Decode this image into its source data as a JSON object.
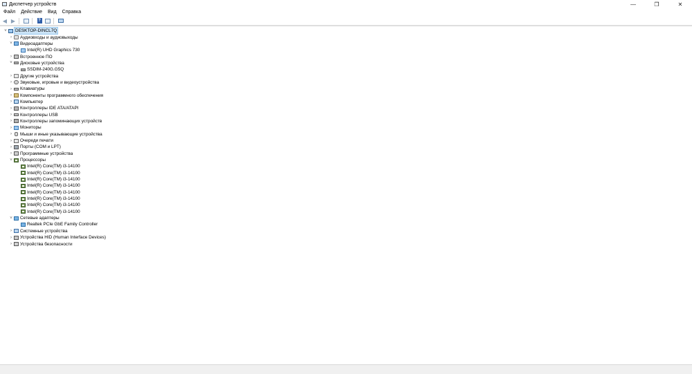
{
  "window": {
    "title": "Диспетчер устройств",
    "minimize_glyph": "—",
    "restore_glyph": "❐",
    "close_glyph": "✕"
  },
  "menu": [
    "Файл",
    "Действие",
    "Вид",
    "Справка"
  ],
  "toolbar": {
    "back_glyph": "◀",
    "forward_glyph": "▶",
    "help_glyph": "?"
  },
  "tree": [
    {
      "level": 0,
      "expander": "˅",
      "icon": "computer-icon",
      "label": "DESKTOP-DINCL7Q",
      "selected": true
    },
    {
      "level": 1,
      "expander": "›",
      "icon": "audio-io-icon",
      "label": "Аудиовходы и аудиовыходы"
    },
    {
      "level": 1,
      "expander": "˅",
      "icon": "display-adapter-icon",
      "label": "Видеоадаптеры"
    },
    {
      "level": 2,
      "expander": "",
      "icon": "monitor-icon",
      "label": "Intel(R) UHD Graphics 730"
    },
    {
      "level": 1,
      "expander": "›",
      "icon": "firmware-icon",
      "label": "Встроенное ПО"
    },
    {
      "level": 1,
      "expander": "˅",
      "icon": "disk-drive-icon",
      "label": "Дисковые устройства"
    },
    {
      "level": 2,
      "expander": "",
      "icon": "disk-icon",
      "label": "SSDIM-240G.G5Q"
    },
    {
      "level": 1,
      "expander": "›",
      "icon": "other-devices-icon",
      "label": "Другие устройства"
    },
    {
      "level": 1,
      "expander": "›",
      "icon": "sound-icon",
      "label": "Звуковые, игровые и видеоустройства"
    },
    {
      "level": 1,
      "expander": "›",
      "icon": "keyboard-icon",
      "label": "Клавиатуры"
    },
    {
      "level": 1,
      "expander": "›",
      "icon": "software-component-icon",
      "label": "Компоненты программного обеспечения"
    },
    {
      "level": 1,
      "expander": "›",
      "icon": "pc-icon",
      "label": "Компьютер"
    },
    {
      "level": 1,
      "expander": "›",
      "icon": "ide-controller-icon",
      "label": "Контроллеры IDE ATA/ATAPI"
    },
    {
      "level": 1,
      "expander": "›",
      "icon": "usb-controller-icon",
      "label": "Контроллеры USB"
    },
    {
      "level": 1,
      "expander": "›",
      "icon": "storage-controller-icon",
      "label": "Контроллеры запоминающих устройств"
    },
    {
      "level": 1,
      "expander": "›",
      "icon": "monitors-icon",
      "label": "Мониторы"
    },
    {
      "level": 1,
      "expander": "›",
      "icon": "mouse-icon",
      "label": "Мыши и иные указывающие устройства"
    },
    {
      "level": 1,
      "expander": "›",
      "icon": "print-queue-icon",
      "label": "Очереди печати"
    },
    {
      "level": 1,
      "expander": "›",
      "icon": "port-icon",
      "label": "Порты (COM и LPT)"
    },
    {
      "level": 1,
      "expander": "›",
      "icon": "software-device-icon",
      "label": "Программные устройства"
    },
    {
      "level": 1,
      "expander": "˅",
      "icon": "processor-icon",
      "label": "Процессоры"
    },
    {
      "level": 2,
      "expander": "",
      "icon": "processor-icon",
      "label": "Intel(R) Core(TM) i3-14100"
    },
    {
      "level": 2,
      "expander": "",
      "icon": "processor-icon",
      "label": "Intel(R) Core(TM) i3-14100"
    },
    {
      "level": 2,
      "expander": "",
      "icon": "processor-icon",
      "label": "Intel(R) Core(TM) i3-14100"
    },
    {
      "level": 2,
      "expander": "",
      "icon": "processor-icon",
      "label": "Intel(R) Core(TM) i3-14100"
    },
    {
      "level": 2,
      "expander": "",
      "icon": "processor-icon",
      "label": "Intel(R) Core(TM) i3-14100"
    },
    {
      "level": 2,
      "expander": "",
      "icon": "processor-icon",
      "label": "Intel(R) Core(TM) i3-14100"
    },
    {
      "level": 2,
      "expander": "",
      "icon": "processor-icon",
      "label": "Intel(R) Core(TM) i3-14100"
    },
    {
      "level": 2,
      "expander": "",
      "icon": "processor-icon",
      "label": "Intel(R) Core(TM) i3-14100"
    },
    {
      "level": 1,
      "expander": "˅",
      "icon": "network-adapter-icon",
      "label": "Сетевые адаптеры"
    },
    {
      "level": 2,
      "expander": "",
      "icon": "network-adapter-icon",
      "label": "Realtek PCIe GbE Family Controller"
    },
    {
      "level": 1,
      "expander": "›",
      "icon": "system-devices-icon",
      "label": "Системные устройства"
    },
    {
      "level": 1,
      "expander": "›",
      "icon": "hid-icon",
      "label": "Устройства HID (Human Interface Devices)"
    },
    {
      "level": 1,
      "expander": "›",
      "icon": "security-device-icon",
      "label": "Устройства безопасности"
    }
  ]
}
